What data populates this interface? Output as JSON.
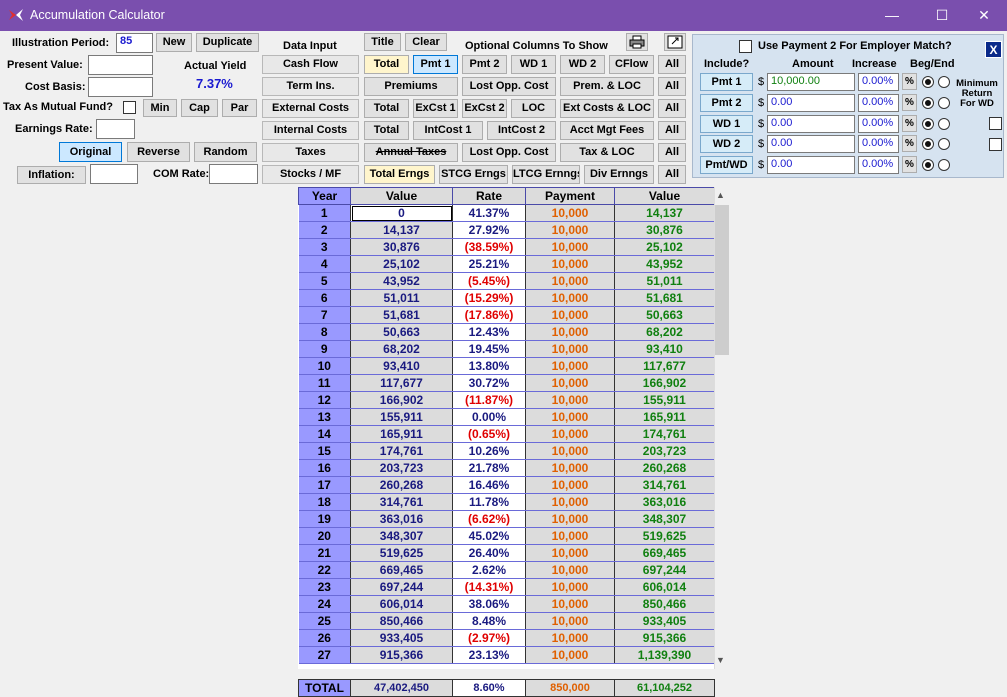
{
  "window": {
    "title": "Accumulation Calculator",
    "minimize_icon": "minimize-icon",
    "maximize_icon": "maximize-icon",
    "close_icon": "close-icon",
    "min_glyph": "—",
    "max_glyph": "☐",
    "close_glyph": "✕"
  },
  "left": {
    "illustration_period_label": "Illustration Period:",
    "illustration_period_value": "85",
    "new_button": "New",
    "duplicate_button": "Duplicate",
    "present_value_label": "Present Value:",
    "present_value": "",
    "actual_yield_label": "Actual Yield",
    "actual_yield_value": "7.37%",
    "cost_basis_label": "Cost Basis:",
    "cost_basis": "",
    "tax_mf_label": "Tax As Mutual Fund?",
    "min_button": "Min",
    "cap_button": "Cap",
    "par_button": "Par",
    "earnings_rate_label": "Earnings Rate:",
    "earnings_rate": "",
    "original_button": "Original",
    "reverse_button": "Reverse",
    "random_button": "Random",
    "inflation_button": "Inflation:",
    "inflation_value": "",
    "com_rate_label": "COM Rate:",
    "com_rate_value": ""
  },
  "middle": {
    "data_input_label": "Data Input",
    "buttons": [
      "Cash Flow",
      "Term Ins.",
      "External Costs",
      "Internal Costs",
      "Taxes",
      "Stocks / MF"
    ]
  },
  "optional": {
    "title_button": "Title",
    "clear_button": "Clear",
    "label": "Optional Columns To Show",
    "print_icon": "printer-icon",
    "export_icon": "export-icon",
    "rows": [
      [
        "Total",
        "Pmt 1",
        "Pmt 2",
        "WD 1",
        "WD 2",
        "CFlow",
        "All"
      ],
      [
        "Premiums",
        "Lost Opp. Cost",
        "Prem. & LOC",
        "All"
      ],
      [
        "Total",
        "ExCst 1",
        "ExCst 2",
        "LOC",
        "Ext Costs & LOC",
        "All"
      ],
      [
        "Total",
        "IntCost 1",
        "IntCost 2",
        "Acct Mgt Fees",
        "All"
      ],
      [
        "Annual Taxes",
        "Lost Opp. Cost",
        "Tax & LOC",
        "All"
      ],
      [
        "Total Erngs",
        "STCG Erngs",
        "LTCG Ernngs",
        "Div Ernngs",
        "All"
      ]
    ]
  },
  "panel": {
    "use_payment2_label": "Use Payment 2 For Employer Match?",
    "close_label": "X",
    "include_header": "Include?",
    "amount_header": "Amount",
    "increase_header": "Increase",
    "begend_header": "Beg/End",
    "min_return_label": "Minimum Return For WD",
    "rows": [
      {
        "label": "Pmt 1",
        "currency": "$",
        "amount": "10,000.00",
        "increase": "0.00%",
        "pct": "%"
      },
      {
        "label": "Pmt 2",
        "currency": "$",
        "amount": "0.00",
        "increase": "0.00%",
        "pct": "%"
      },
      {
        "label": "WD 1",
        "currency": "$",
        "amount": "0.00",
        "increase": "0.00%",
        "pct": "%"
      },
      {
        "label": "WD 2",
        "currency": "$",
        "amount": "0.00",
        "increase": "0.00%",
        "pct": "%"
      },
      {
        "label": "Pmt/WD",
        "currency": "$",
        "amount": "0.00",
        "increase": "0.00%",
        "pct": "%"
      }
    ]
  },
  "table": {
    "headers": [
      "Year",
      "Value",
      "Rate",
      "Payment",
      "Value"
    ],
    "rows": [
      [
        "1",
        "0",
        "41.37%",
        "10,000",
        "14,137"
      ],
      [
        "2",
        "14,137",
        "27.92%",
        "10,000",
        "30,876"
      ],
      [
        "3",
        "30,876",
        "(38.59%)",
        "10,000",
        "25,102"
      ],
      [
        "4",
        "25,102",
        "25.21%",
        "10,000",
        "43,952"
      ],
      [
        "5",
        "43,952",
        "(5.45%)",
        "10,000",
        "51,011"
      ],
      [
        "6",
        "51,011",
        "(15.29%)",
        "10,000",
        "51,681"
      ],
      [
        "7",
        "51,681",
        "(17.86%)",
        "10,000",
        "50,663"
      ],
      [
        "8",
        "50,663",
        "12.43%",
        "10,000",
        "68,202"
      ],
      [
        "9",
        "68,202",
        "19.45%",
        "10,000",
        "93,410"
      ],
      [
        "10",
        "93,410",
        "13.80%",
        "10,000",
        "117,677"
      ],
      [
        "11",
        "117,677",
        "30.72%",
        "10,000",
        "166,902"
      ],
      [
        "12",
        "166,902",
        "(11.87%)",
        "10,000",
        "155,911"
      ],
      [
        "13",
        "155,911",
        "0.00%",
        "10,000",
        "165,911"
      ],
      [
        "14",
        "165,911",
        "(0.65%)",
        "10,000",
        "174,761"
      ],
      [
        "15",
        "174,761",
        "10.26%",
        "10,000",
        "203,723"
      ],
      [
        "16",
        "203,723",
        "21.78%",
        "10,000",
        "260,268"
      ],
      [
        "17",
        "260,268",
        "16.46%",
        "10,000",
        "314,761"
      ],
      [
        "18",
        "314,761",
        "11.78%",
        "10,000",
        "363,016"
      ],
      [
        "19",
        "363,016",
        "(6.62%)",
        "10,000",
        "348,307"
      ],
      [
        "20",
        "348,307",
        "45.02%",
        "10,000",
        "519,625"
      ],
      [
        "21",
        "519,625",
        "26.40%",
        "10,000",
        "669,465"
      ],
      [
        "22",
        "669,465",
        "2.62%",
        "10,000",
        "697,244"
      ],
      [
        "23",
        "697,244",
        "(14.31%)",
        "10,000",
        "606,014"
      ],
      [
        "24",
        "606,014",
        "38.06%",
        "10,000",
        "850,466"
      ],
      [
        "25",
        "850,466",
        "8.48%",
        "10,000",
        "933,405"
      ],
      [
        "26",
        "933,405",
        "(2.97%)",
        "10,000",
        "915,366"
      ],
      [
        "27",
        "915,366",
        "23.13%",
        "10,000",
        "1,139,390"
      ]
    ],
    "totals": [
      "TOTAL",
      "47,402,450",
      "8.60%",
      "850,000",
      "61,104,252"
    ]
  }
}
